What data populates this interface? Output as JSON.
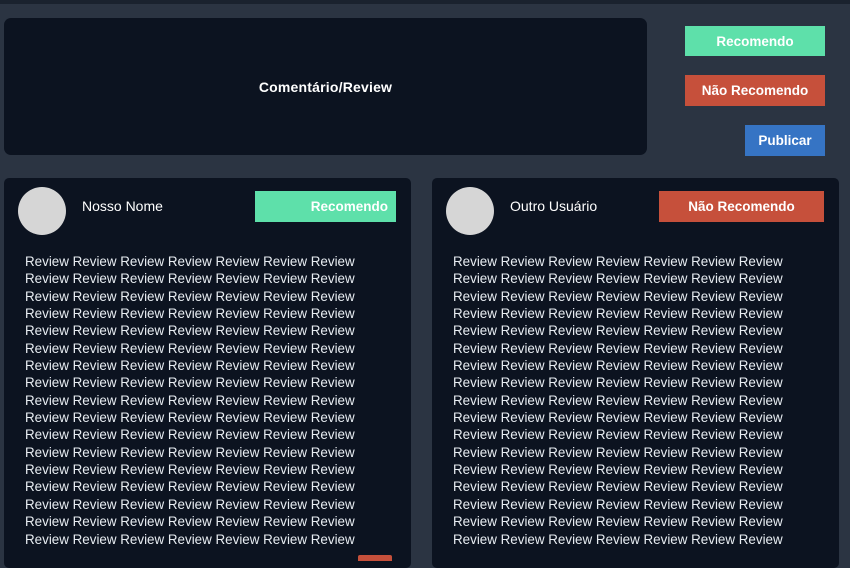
{
  "composer": {
    "placeholder_label": "Comentário/Review"
  },
  "actions": {
    "recommend_label": "Recomendo",
    "not_recommend_label": "Não Recomendo",
    "publish_label": "Publicar"
  },
  "reviews": [
    {
      "user_name": "Nosso Nome",
      "verdict_label": "Recomendo",
      "verdict_color": "#5ee0aa",
      "body": "Review Review Review Review Review Review Review\nReview Review Review Review Review Review Review\nReview Review Review Review Review Review Review\nReview Review Review Review Review Review Review\nReview Review Review Review Review Review Review\nReview Review Review Review Review Review Review\nReview Review Review Review Review Review Review\nReview Review Review Review Review Review Review\nReview Review Review Review Review Review Review\nReview Review Review Review Review Review Review\nReview Review Review Review Review Review Review\nReview Review Review Review Review Review Review\nReview Review Review Review Review Review Review\nReview Review Review Review Review Review Review\nReview Review Review Review Review Review Review\nReview Review Review Review Review Review Review\nReview Review Review Review Review Review Review"
    },
    {
      "user_name": "Outro Usuário",
      "verdict_label": "Não Recomendo",
      "verdict_color": "#c6503b",
      "body": "Review Review Review Review Review Review Review\nReview Review Review Review Review Review Review\nReview Review Review Review Review Review Review\nReview Review Review Review Review Review Review\nReview Review Review Review Review Review Review\nReview Review Review Review Review Review Review\nReview Review Review Review Review Review Review\nReview Review Review Review Review Review Review\nReview Review Review Review Review Review Review\nReview Review Review Review Review Review Review\nReview Review Review Review Review Review Review\nReview Review Review Review Review Review Review\nReview Review Review Review Review Review Review\nReview Review Review Review Review Review Review\nReview Review Review Review Review Review Review\nReview Review Review Review Review Review Review\nReview Review Review Review Review Review Review"
    }
  ],
  "colors": {
    "background": "#2b3442",
    "panel": "#0c1320",
    "recommend": "#5ee0aa",
    "not_recommend": "#c6503b",
    "publish": "#3674c4"
  }
}
